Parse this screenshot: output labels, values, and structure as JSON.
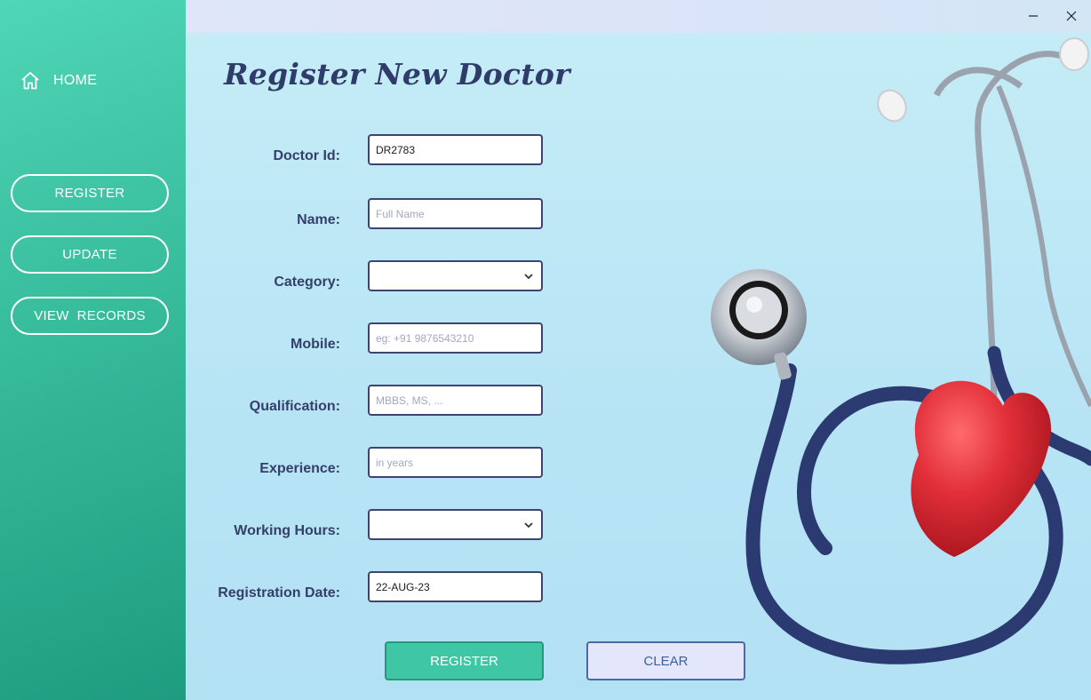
{
  "sidebar": {
    "home_label": "HOME",
    "buttons": [
      {
        "label": "REGISTER"
      },
      {
        "label": "UPDATE"
      },
      {
        "label": "VIEW  RECORDS"
      }
    ]
  },
  "window_controls": {
    "minimize": "minimize-icon",
    "close": "close-icon"
  },
  "form": {
    "title": "Register New Doctor",
    "doctor_id": {
      "label": "Doctor Id:",
      "value": "DR2783"
    },
    "name": {
      "label": "Name:",
      "placeholder": "Full Name"
    },
    "category": {
      "label": "Category:",
      "value": ""
    },
    "mobile": {
      "label": "Mobile:",
      "placeholder": "eg: +91 9876543210"
    },
    "qualification": {
      "label": "Qualification:",
      "placeholder": "MBBS, MS, ..."
    },
    "experience": {
      "label": "Experience:",
      "placeholder": "in years"
    },
    "working_hours": {
      "label": "Working Hours:",
      "value": ""
    },
    "registration_date": {
      "label": "Registration Date:",
      "value": "22-AUG-23"
    }
  },
  "actions": {
    "register_label": "REGISTER",
    "clear_label": "CLEAR"
  },
  "colors": {
    "sidebar": "#37bc9c",
    "title": "#2f3b68",
    "register_button": "#3fc7a5",
    "clear_button": "#e4e7fb",
    "heart": "#e02c35",
    "stethoscope": "#2c3a72"
  }
}
